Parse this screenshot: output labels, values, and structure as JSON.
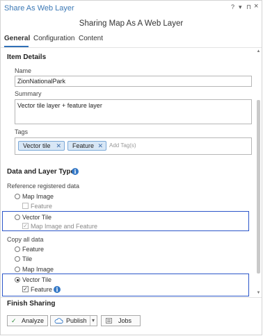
{
  "pane": {
    "title": "Share As Web Layer",
    "help_glyph": "?",
    "menu_glyph": "▾",
    "pin_glyph": "⊓",
    "close_glyph": "×"
  },
  "heading": "Sharing Map As A Web Layer",
  "tabs": [
    {
      "label": "General"
    },
    {
      "label": "Configuration"
    },
    {
      "label": "Content"
    }
  ],
  "item_details": {
    "title": "Item Details",
    "name_label": "Name",
    "name_value": "ZionNationalPark",
    "summary_label": "Summary",
    "summary_value": "Vector tile layer + feature layer",
    "tags_label": "Tags",
    "tags": [
      {
        "label": "Vector tile"
      },
      {
        "label": "Feature"
      }
    ],
    "tag_remove_glyph": "✕",
    "add_tag_placeholder": "Add Tag(s)"
  },
  "data_layer": {
    "title": "Data and Layer Type",
    "info_glyph": "i",
    "reference_label": "Reference registered data",
    "reference_options": {
      "map_image": "Map Image",
      "feature": "Feature",
      "vector_tile": "Vector Tile",
      "map_image_and_feature": "Map Image and Feature"
    },
    "copy_label": "Copy all data",
    "copy_options": {
      "feature": "Feature",
      "tile": "Tile",
      "map_image": "Map Image",
      "vector_tile": "Vector Tile",
      "feature_check": "Feature"
    },
    "check_glyph": "✓"
  },
  "finish": {
    "title": "Finish Sharing",
    "analyze_label": "Analyze",
    "publish_label": "Publish",
    "publish_dropdown_glyph": "▾",
    "jobs_label": "Jobs"
  },
  "colors": {
    "accent": "#2f6fb7",
    "highlight": "#2b56c9",
    "chip_bg": "#d8e7f6",
    "info_icon": "#3478c6"
  }
}
